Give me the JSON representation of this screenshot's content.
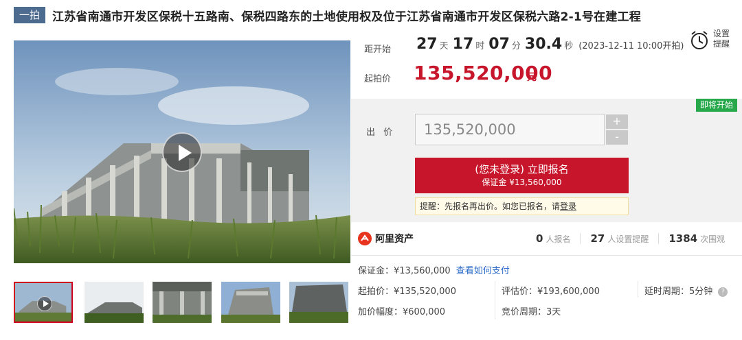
{
  "header": {
    "tag": "一拍",
    "title": "江苏省南通市开发区保税十五路南、保税四路东的土地使用权及位于江苏省南通市开发区保税六路2-1号在建工程"
  },
  "countdown": {
    "label": "距开始",
    "days": "27",
    "days_unit": "天",
    "hours": "17",
    "hours_unit": "时",
    "minutes": "07",
    "minutes_unit": "分",
    "seconds": "30.4",
    "seconds_unit": "秒",
    "start_note": "(2023-12-11 10:00开拍)"
  },
  "reminder": {
    "line1": "设置",
    "line2": "提醒"
  },
  "starting_price": {
    "label": "起拍价",
    "value": "135,520,000",
    "unit": "元"
  },
  "bid": {
    "badge": "即将开始",
    "label": "出 价",
    "value": "135,520,000",
    "plus": "+",
    "minus": "-",
    "signup_main": "(您未登录) 立即报名",
    "signup_sub": "保证金 ¥13,560,000",
    "tip_prefix": "提醒：先报名再出价。如您已报名，请",
    "tip_link": "登录"
  },
  "brand": {
    "name": "阿里资产"
  },
  "stats": [
    {
      "num": "0",
      "label": "人报名"
    },
    {
      "num": "27",
      "label": "人设置提醒"
    },
    {
      "num": "1384",
      "label": "次围观"
    }
  ],
  "details": {
    "deposit": "保证金：¥13,560,000",
    "pay_link": "查看如何支付",
    "start_price": "起拍价：¥135,520,000",
    "appraisal": "评估价：¥193,600,000",
    "delay_period": "延时周期：5分钟",
    "increment": "加价幅度：¥600,000",
    "bid_period": "竞价周期：3天",
    "help": "?"
  },
  "colors": {
    "accent": "#c7152b",
    "badge_green": "#27a84a",
    "tag_blue": "#4d6a8f",
    "link": "#2b6ac8"
  }
}
